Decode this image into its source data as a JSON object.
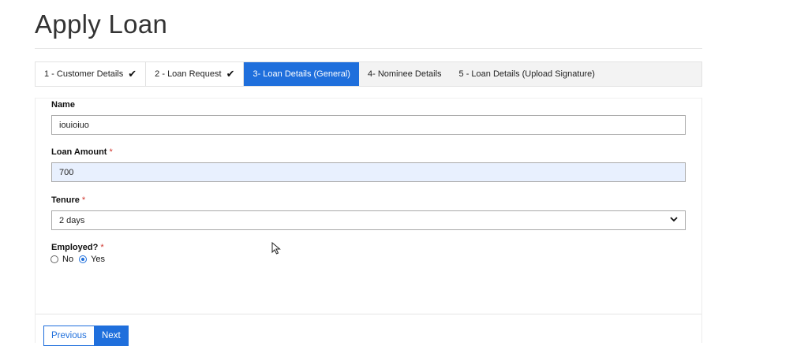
{
  "page": {
    "title": "Apply Loan"
  },
  "steps": [
    {
      "label": "1 - Customer Details",
      "status": "done",
      "icon": "check-icon"
    },
    {
      "label": "2 - Loan Request",
      "status": "done",
      "icon": "check-icon"
    },
    {
      "label": "3- Loan Details (General)",
      "status": "active"
    },
    {
      "label": "4- Nominee Details",
      "status": "pending"
    },
    {
      "label": "5 - Loan Details (Upload Signature)",
      "status": "pending"
    }
  ],
  "form": {
    "name": {
      "label": "Name",
      "value": "iouioiuo"
    },
    "loan_amount": {
      "label": "Loan Amount",
      "required_mark": "*",
      "value": "700"
    },
    "tenure": {
      "label": "Tenure",
      "required_mark": "*",
      "selected": "2 days",
      "icon": "chevron-down-icon"
    },
    "employed": {
      "label": "Employed?",
      "required_mark": "*",
      "options": [
        {
          "label": "No",
          "checked": false
        },
        {
          "label": "Yes",
          "checked": true
        }
      ]
    }
  },
  "buttons": {
    "previous": "Previous",
    "next": "Next"
  },
  "colors": {
    "accent": "#1f6fdc",
    "required": "#d0342c",
    "autofill_bg": "#e8f0fe"
  }
}
